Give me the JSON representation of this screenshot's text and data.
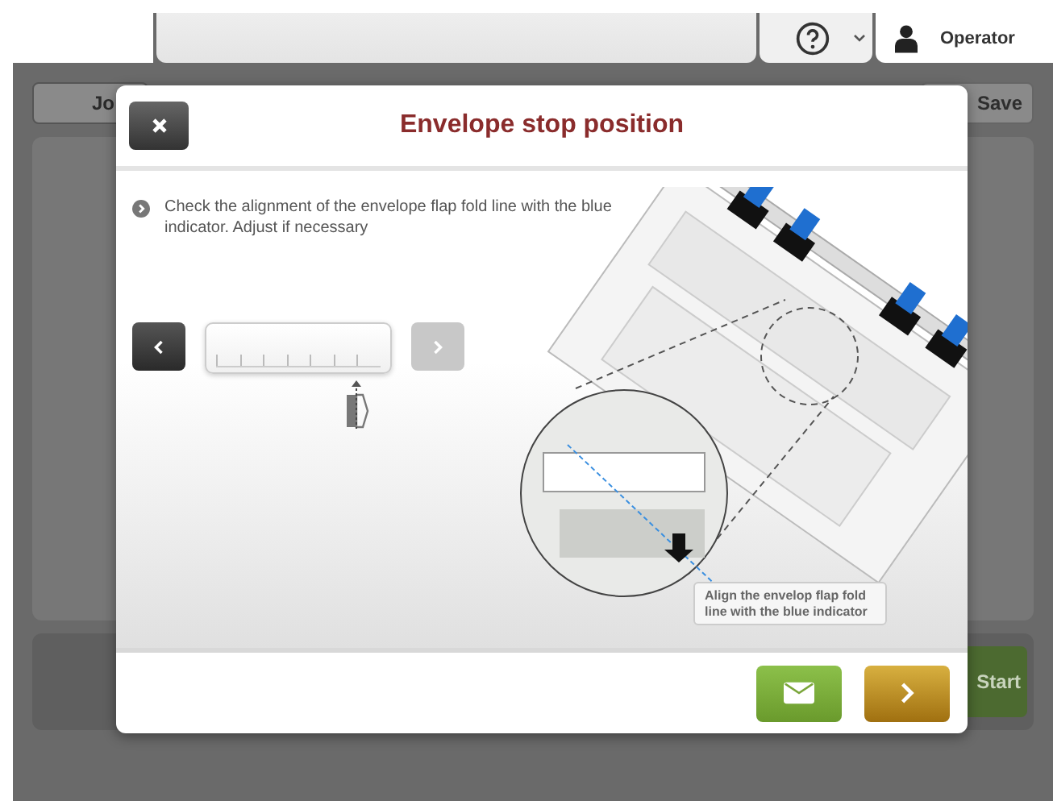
{
  "top_bar": {
    "help_menu": {
      "expanded": false
    },
    "user": {
      "name": "Operator"
    }
  },
  "background": {
    "back_button": {
      "label": "Jo"
    },
    "save_button": {
      "label": "Save"
    },
    "start_button": {
      "label": "Start"
    }
  },
  "dialog": {
    "title": "Envelope stop position",
    "instruction": "Check the alignment of the envelope flap fold line with the blue indicator. Adjust if necessary",
    "adjuster": {
      "previous": {
        "disabled": false
      },
      "next": {
        "disabled": true
      }
    },
    "callout": "Align the envelop flap fold line with the blue indicator"
  }
}
